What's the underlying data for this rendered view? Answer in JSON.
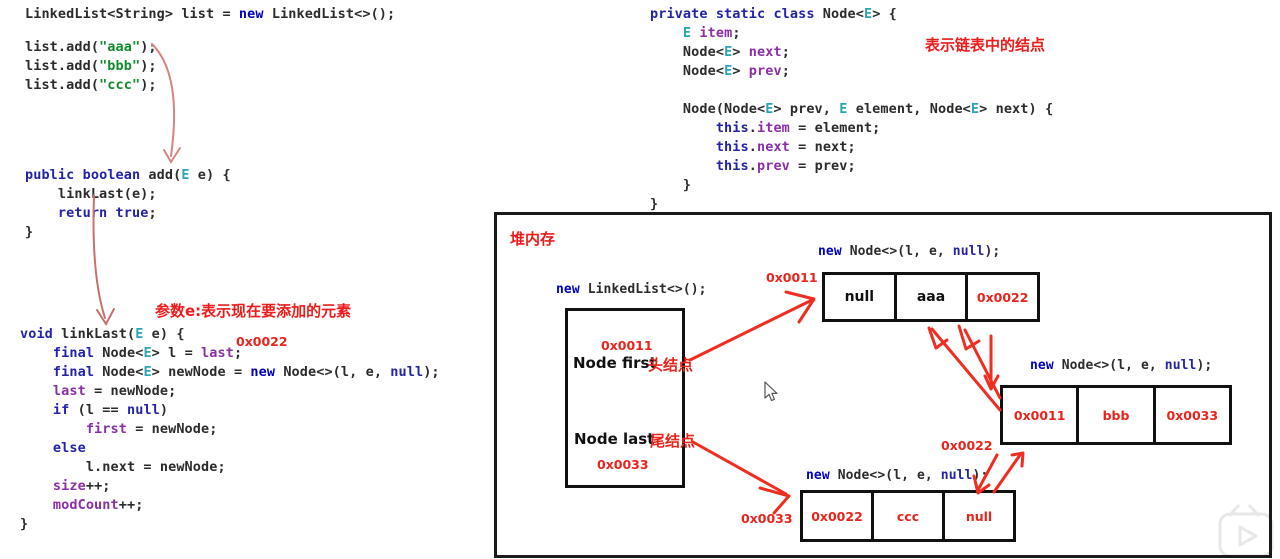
{
  "colors": {
    "red": "#e8241c",
    "keyword_blue": "#2222aa",
    "type_teal": "#2aa5b5",
    "field_purple": "#8b2fa8",
    "string_green": "#128a2e",
    "ink": "#111111"
  },
  "code_usage": {
    "lines": [
      "LinkedList<String> list = new LinkedList<>();",
      "list.add(\"aaa\");",
      "list.add(\"bbb\");",
      "list.add(\"ccc\");"
    ]
  },
  "code_add": {
    "lines": [
      "public boolean add(E e) {",
      "    linkLast(e);",
      "    return true;",
      "}"
    ]
  },
  "code_linklast": {
    "lines": [
      "void linkLast(E e) {",
      "    final Node<E> l = last;",
      "    final Node<E> newNode = new Node<>(l, e, null);",
      "    last = newNode;",
      "    if (l == null)",
      "        first = newNode;",
      "    else",
      "        l.next = newNode;",
      "    size++;",
      "    modCount++;",
      "}"
    ],
    "inline_addr": "0x0022",
    "note": "参数e:表示现在要添加的元素"
  },
  "code_node_class": {
    "lines": [
      "private static class Node<E> {",
      "    E item;",
      "    Node<E> next;",
      "    Node<E> prev;",
      "",
      "    Node(Node<E> prev, E element, Node<E> next) {",
      "        this.item = element;",
      "        this.next = next;",
      "        this.prev = prev;",
      "    }",
      "}"
    ],
    "note": "表示链表中的结点"
  },
  "heap": {
    "title": "堆内存",
    "linkedlist": {
      "caption": "new LinkedList<>();",
      "first_addr": "0x0011",
      "first_label": "Node first",
      "first_note": "头结点",
      "last_label": "Node last",
      "last_note": "尾结点",
      "last_addr": "0x0033"
    },
    "node_aaa": {
      "caption": "new Node<>(l, e, null);",
      "addr": "0x0011",
      "cells": [
        "null",
        "aaa",
        "0x0022"
      ]
    },
    "node_bbb": {
      "caption": "new Node<>(l, e, null);",
      "addr": "0x0022",
      "cells": [
        "0x0011",
        "bbb",
        "0x0033"
      ]
    },
    "node_ccc": {
      "caption": "new Node<>(l, e, null);",
      "addr": "0x0033",
      "cells": [
        "0x0022",
        "ccc",
        "null"
      ]
    }
  }
}
